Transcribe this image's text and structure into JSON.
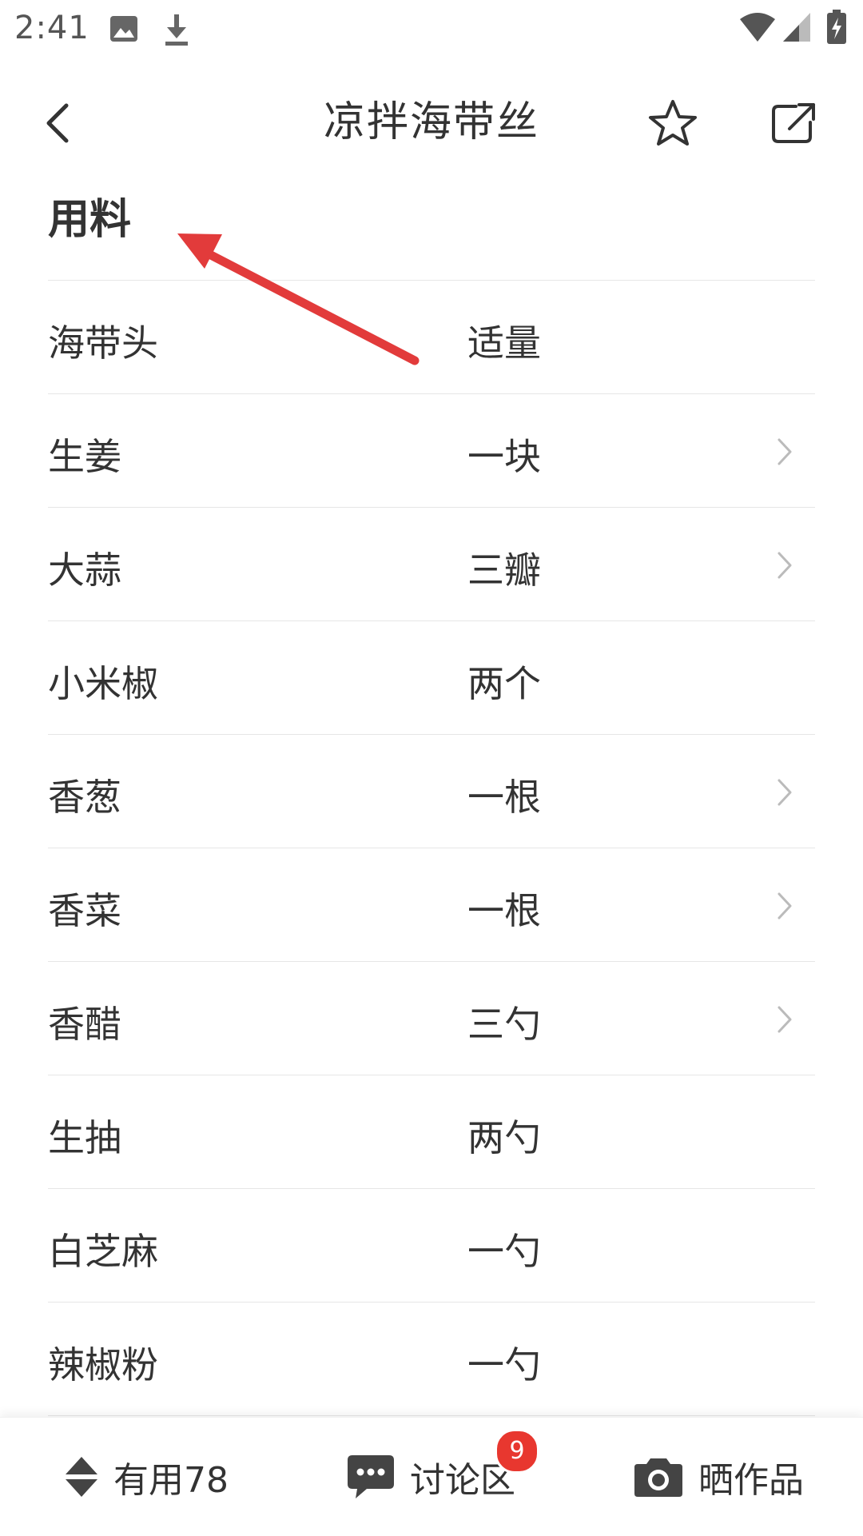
{
  "status_bar": {
    "time": "2:41",
    "icons": [
      "image-icon",
      "download-icon",
      "wifi-icon",
      "signal-icon",
      "battery-charging-icon"
    ]
  },
  "header": {
    "title": "凉拌海带丝",
    "icons": [
      "back-icon",
      "star-icon",
      "share-icon"
    ]
  },
  "section": {
    "title": "用料"
  },
  "ingredients": [
    {
      "name": "海带头",
      "amount": "适量",
      "has_link": false
    },
    {
      "name": "生姜",
      "amount": "一块",
      "has_link": true
    },
    {
      "name": "大蒜",
      "amount": "三瓣",
      "has_link": true
    },
    {
      "name": "小米椒",
      "amount": "两个",
      "has_link": false
    },
    {
      "name": "香葱",
      "amount": "一根",
      "has_link": true
    },
    {
      "name": "香菜",
      "amount": "一根",
      "has_link": true
    },
    {
      "name": "香醋",
      "amount": "三勺",
      "has_link": true
    },
    {
      "name": "生抽",
      "amount": "两勺",
      "has_link": false
    },
    {
      "name": "白芝麻",
      "amount": "一勺",
      "has_link": false
    },
    {
      "name": "辣椒粉",
      "amount": "一勺",
      "has_link": false
    }
  ],
  "bottom_bar": {
    "useful_label": "有用78",
    "discuss_label": "讨论区",
    "discuss_badge": "9",
    "showcase_label": "晒作品"
  },
  "colors": {
    "accent": "#e8372f",
    "text": "#333333",
    "divider": "#e6e6e6",
    "icon": "#555555",
    "annotation_arrow": "#e23b3b"
  }
}
